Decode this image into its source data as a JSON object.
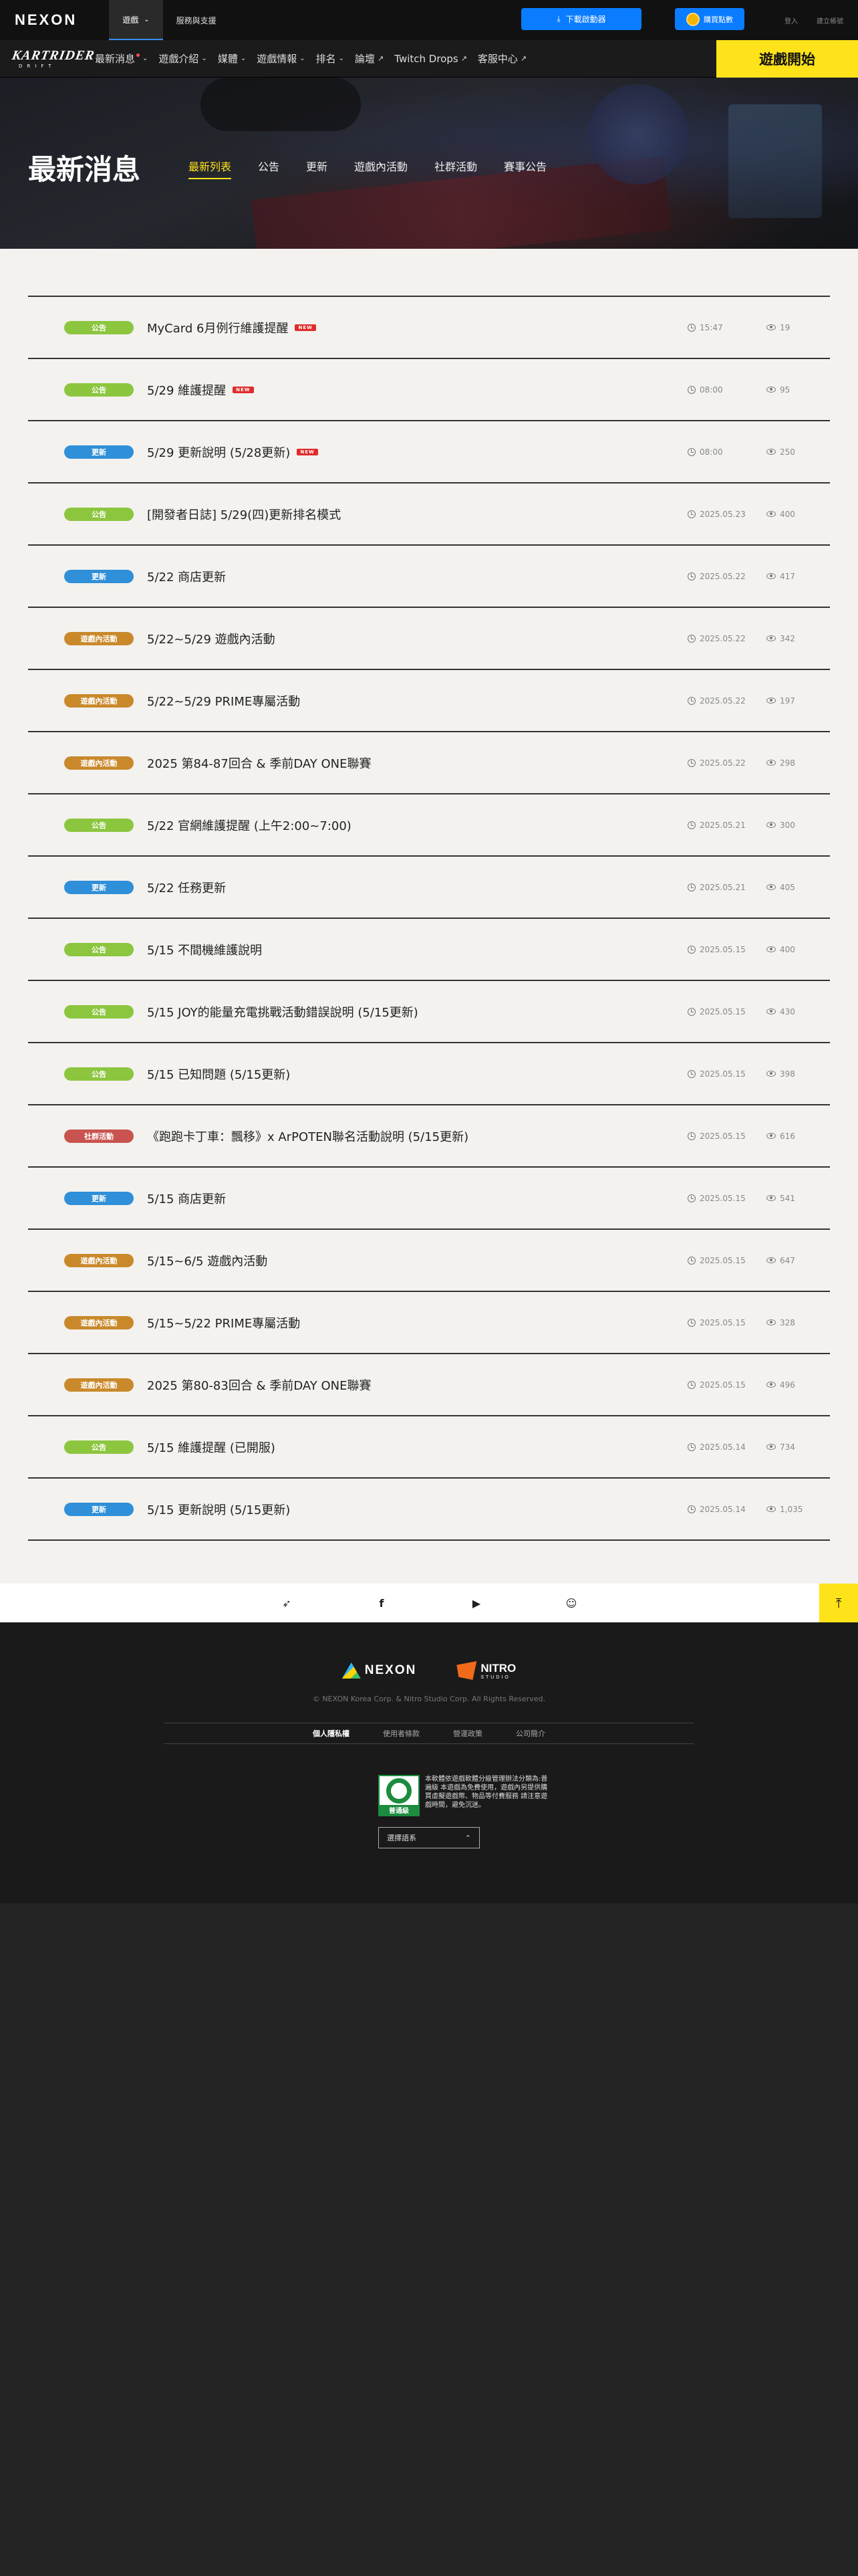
{
  "topbar": {
    "logo": "NEXON",
    "menu": [
      {
        "label": "遊戲",
        "active": true
      },
      {
        "label": "服務與支援",
        "active": false
      }
    ],
    "download_label": "下載啟動器",
    "points_label": "購買點數",
    "links": [
      "登入",
      "建立帳號"
    ]
  },
  "gamenav": {
    "logo_text": "KARTRIDER",
    "logo_sub": "DRIFT",
    "items": [
      {
        "label": "最新消息",
        "chevron": true,
        "dot": true
      },
      {
        "label": "遊戲介紹",
        "chevron": true
      },
      {
        "label": "媒體",
        "chevron": true
      },
      {
        "label": "遊戲情報",
        "chevron": true
      },
      {
        "label": "排名",
        "chevron": true
      },
      {
        "label": "論壇",
        "external": true
      },
      {
        "label": "Twitch Drops",
        "external": true
      },
      {
        "label": "客服中心",
        "external": true
      }
    ],
    "play_label": "遊戲開始"
  },
  "hero": {
    "title": "最新消息",
    "tabs": [
      "最新列表",
      "公告",
      "更新",
      "遊戲內活動",
      "社群活動",
      "賽事公告"
    ],
    "active_tab": 0
  },
  "colors": {
    "公告": "#8cc63f",
    "更新": "#2f8fd8",
    "遊戲內活動": "#c9892b",
    "社群活動": "#c9534f",
    "accent": "#ffe31a"
  },
  "news": [
    {
      "category": "公告",
      "title": "MyCard 6月例行維護提醒",
      "new": true,
      "date": "15:47",
      "views": "19"
    },
    {
      "category": "公告",
      "title": "5/29 維護提醒",
      "new": true,
      "date": "08:00",
      "views": "95"
    },
    {
      "category": "更新",
      "title": "5/29 更新說明 (5/28更新)",
      "new": true,
      "date": "08:00",
      "views": "250"
    },
    {
      "category": "公告",
      "title": "[開發者日誌] 5/29(四)更新排名模式",
      "new": false,
      "date": "2025.05.23",
      "views": "400"
    },
    {
      "category": "更新",
      "title": "5/22 商店更新",
      "new": false,
      "date": "2025.05.22",
      "views": "417"
    },
    {
      "category": "遊戲內活動",
      "title": "5/22~5/29 遊戲內活動",
      "new": false,
      "date": "2025.05.22",
      "views": "342"
    },
    {
      "category": "遊戲內活動",
      "title": "5/22~5/29 PRIME專屬活動",
      "new": false,
      "date": "2025.05.22",
      "views": "197"
    },
    {
      "category": "遊戲內活動",
      "title": "2025 第84-87回合 & 季前DAY ONE聯賽",
      "new": false,
      "date": "2025.05.22",
      "views": "298"
    },
    {
      "category": "公告",
      "title": "5/22 官網維護提醒 (上午2:00~7:00)",
      "new": false,
      "date": "2025.05.21",
      "views": "300"
    },
    {
      "category": "更新",
      "title": "5/22 任務更新",
      "new": false,
      "date": "2025.05.21",
      "views": "405"
    },
    {
      "category": "公告",
      "title": "5/15 不間機維護說明",
      "new": false,
      "date": "2025.05.15",
      "views": "400"
    },
    {
      "category": "公告",
      "title": "5/15 JOY的能量充電挑戰活動錯誤說明 (5/15更新)",
      "new": false,
      "date": "2025.05.15",
      "views": "430"
    },
    {
      "category": "公告",
      "title": "5/15 已知問題 (5/15更新)",
      "new": false,
      "date": "2025.05.15",
      "views": "398"
    },
    {
      "category": "社群活動",
      "title": "《跑跑卡丁車：飄移》x ArPOTEN聯名活動說明 (5/15更新)",
      "new": false,
      "date": "2025.05.15",
      "views": "616"
    },
    {
      "category": "更新",
      "title": "5/15 商店更新",
      "new": false,
      "date": "2025.05.15",
      "views": "541"
    },
    {
      "category": "遊戲內活動",
      "title": "5/15~6/5 遊戲內活動",
      "new": false,
      "date": "2025.05.15",
      "views": "647"
    },
    {
      "category": "遊戲內活動",
      "title": "5/15~5/22 PRIME專屬活動",
      "new": false,
      "date": "2025.05.15",
      "views": "328"
    },
    {
      "category": "遊戲內活動",
      "title": "2025 第80-83回合 & 季前DAY ONE聯賽",
      "new": false,
      "date": "2025.05.15",
      "views": "496"
    },
    {
      "category": "公告",
      "title": "5/15 維護提醒 (已開服)",
      "new": false,
      "date": "2025.05.14",
      "views": "734"
    },
    {
      "category": "更新",
      "title": "5/15 更新說明 (5/15更新)",
      "new": false,
      "date": "2025.05.14",
      "views": "1,035"
    }
  ],
  "new_tag": "NEW",
  "social": {
    "icons": [
      "kartrider-icon",
      "facebook-icon",
      "youtube-icon",
      "discord-icon"
    ],
    "top_label": "TOP"
  },
  "footer": {
    "nexon_logo": "NEXON",
    "nitro_logo": "NITRO",
    "nitro_sub": "STUDIO",
    "copyright": "© NEXON Korea Corp. & Nitro Studio Corp. All Rights Reserved.",
    "links": [
      "個人隱私權",
      "使用者條款",
      "營運政策",
      "公司簡介"
    ],
    "rating_label": "普通級",
    "rating_text": "本軟體依遊戲軟體分級管理辦法分類為:普遍級 本遊戲為免費使用，遊戲內另提供購買虛擬遊戲幣、物品等付費服務 請注意遊戲時間，避免沉迷。",
    "lang_label": "選擇語系"
  }
}
